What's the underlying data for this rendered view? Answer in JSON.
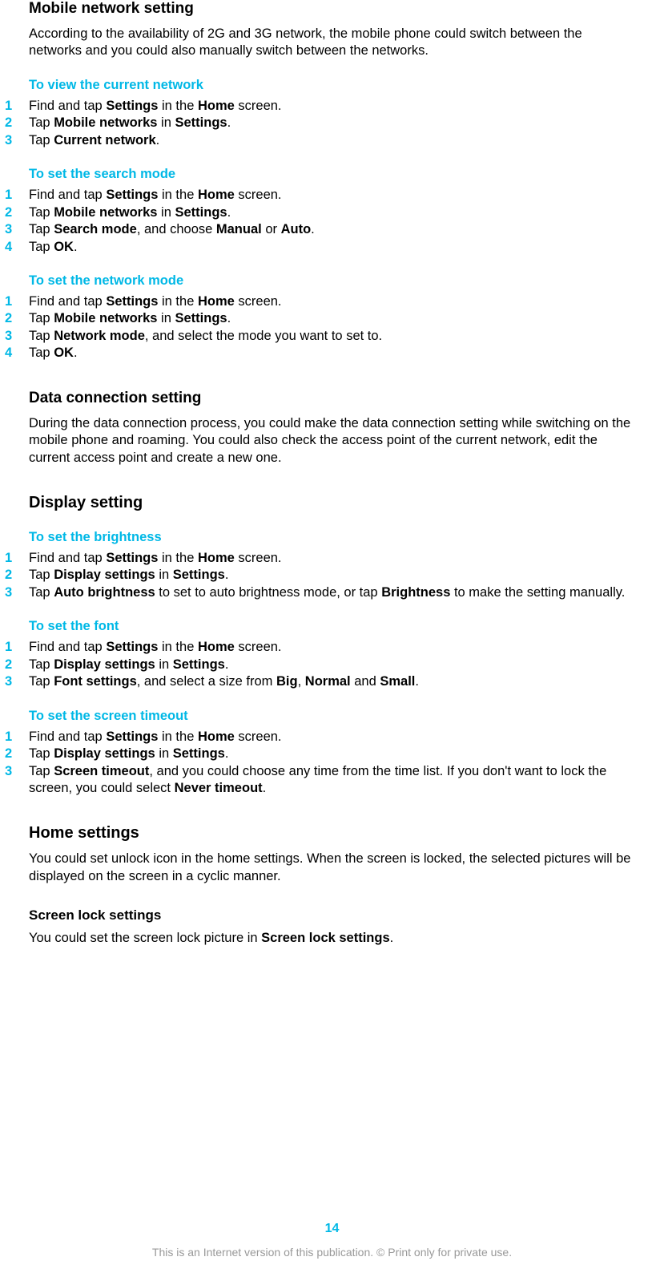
{
  "mobile_network": {
    "title": "Mobile network setting",
    "intro": "According to the availability of 2G and 3G network, the mobile phone could switch between the networks and you could also manually switch between the networks.",
    "view_current": {
      "heading": "To view the current network",
      "steps": [
        "Find and tap <b>Settings</b> in the <b>Home</b> screen.",
        "Tap <b>Mobile networks</b> in <b>Settings</b>.",
        "Tap <b>Current network</b>."
      ]
    },
    "search_mode": {
      "heading": "To set the search mode",
      "steps": [
        "Find and tap <b>Settings</b> in the <b>Home</b> screen.",
        "Tap <b>Mobile networks</b> in <b>Settings</b>.",
        "Tap <b>Search mode</b>, and choose <b>Manual</b> or <b>Auto</b>.",
        "Tap <b>OK</b>."
      ]
    },
    "network_mode": {
      "heading": "To set the network mode",
      "steps": [
        "Find and tap <b>Settings</b> in the <b>Home</b> screen.",
        "Tap <b>Mobile networks</b> in <b>Settings</b>.",
        "Tap <b>Network mode</b>, and select the mode you want to set to.",
        "Tap <b>OK</b>."
      ]
    }
  },
  "data_connection": {
    "title": "Data connection setting",
    "intro": "During the data connection process, you could make the data connection setting while switching on the mobile phone and roaming. You could also check the access point of the current network, edit the current access point and create a new one."
  },
  "display": {
    "title": "Display setting",
    "brightness": {
      "heading": "To set the brightness",
      "steps": [
        "Find and tap <b>Settings</b> in the <b>Home</b> screen.",
        "Tap <b>Display settings</b> in <b>Settings</b>.",
        "Tap <b>Auto brightness</b> to set to auto brightness mode, or tap <b>Brightness</b> to make the setting manually."
      ]
    },
    "font": {
      "heading": "To set the font",
      "steps": [
        "Find and tap <b>Settings</b> in the <b>Home</b> screen.",
        "Tap <b>Display settings</b> in <b>Settings</b>.",
        "Tap <b>Font settings</b>, and select a size from <b>Big</b>, <b>Normal</b> and <b>Small</b>."
      ]
    },
    "timeout": {
      "heading": "To set the screen timeout",
      "steps": [
        "Find and tap <b>Settings</b> in the <b>Home</b> screen.",
        "Tap <b>Display settings</b> in <b>Settings</b>.",
        "Tap <b>Screen timeout</b>, and you could choose any time from the time list. If you don't want to lock the screen, you could select <b>Never timeout</b>."
      ]
    }
  },
  "home": {
    "title": "Home settings",
    "intro": "You could set unlock icon in the home settings. When the screen is locked, the selected pictures will be displayed on the screen in a cyclic manner."
  },
  "screen_lock": {
    "title": "Screen lock settings",
    "intro": "You could set the screen lock picture in <b>Screen lock settings</b>."
  },
  "page_number": "14",
  "footer": "This is an Internet version of this publication. © Print only for private use."
}
